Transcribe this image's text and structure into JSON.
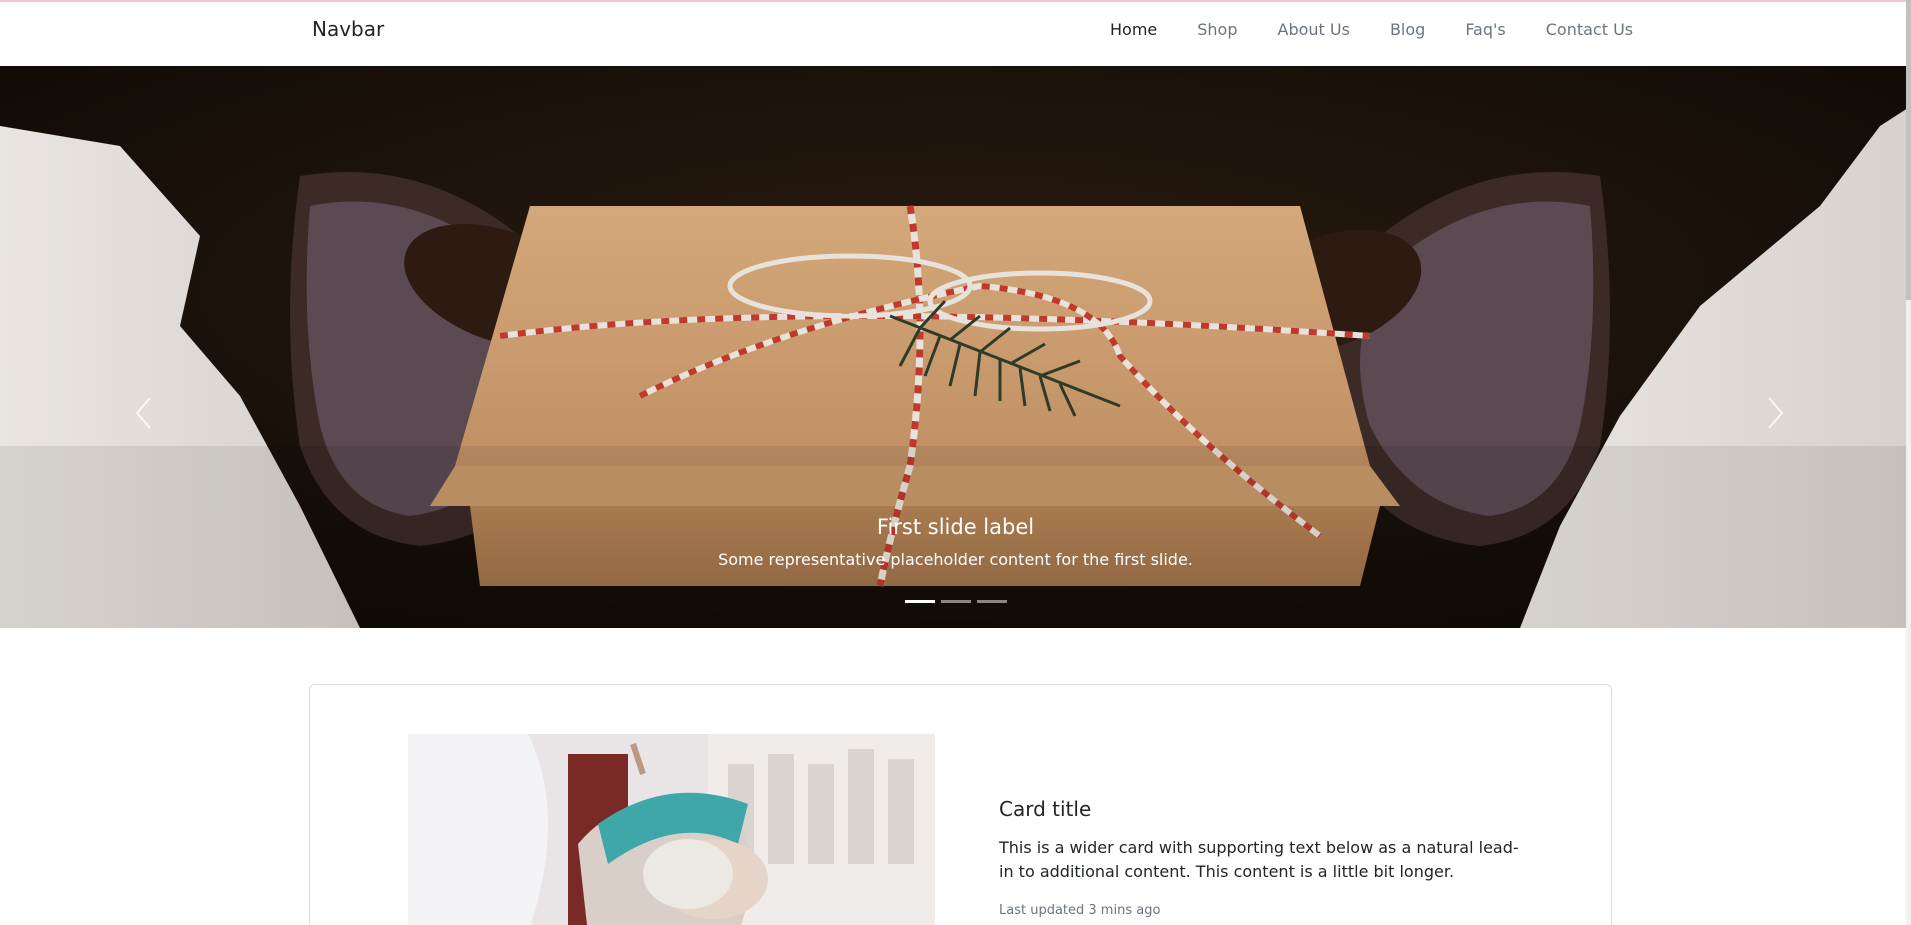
{
  "navbar": {
    "brand": "Navbar",
    "links": [
      "Home",
      "Shop",
      "About Us",
      "Blog",
      "Faq's",
      "Contact Us"
    ],
    "active_index": 0
  },
  "carousel": {
    "caption_title": "First slide label",
    "caption_text": "Some representative placeholder content for the first slide.",
    "prev_icon": "chevron-left-icon",
    "next_icon": "chevron-right-icon",
    "slide_count": 3,
    "active_slide": 0
  },
  "card": {
    "title": "Card title",
    "text": "This is a wider card with supporting text below as a natural lead-in to additional content. This content is a little bit longer.",
    "updated": "Last updated 3 mins ago"
  }
}
